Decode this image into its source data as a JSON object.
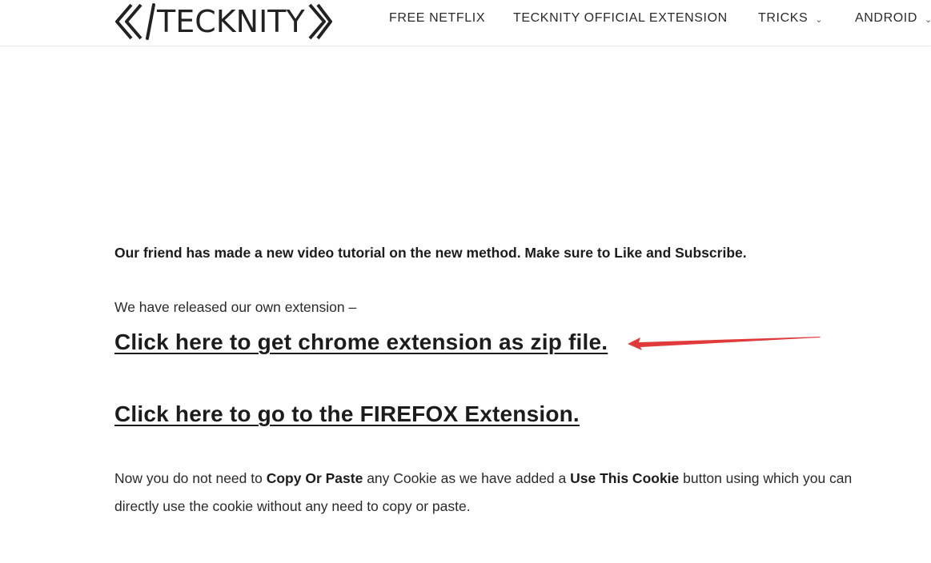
{
  "header": {
    "logo_text": "TECKNITY",
    "nav": [
      {
        "label": "FREE NETFLIX",
        "has_dropdown": false
      },
      {
        "label": "TECKNITY OFFICIAL EXTENSION",
        "has_dropdown": false
      },
      {
        "label": "TRICKS",
        "has_dropdown": true
      },
      {
        "label": "ANDROID",
        "has_dropdown": true
      }
    ],
    "dropdown_icon": "chevron-down-icon"
  },
  "content": {
    "intro": "Our friend has made a new video tutorial on the new method. Make sure to Like and Subscribe.",
    "released": "We have released our own extension –",
    "chrome_link": "Click here to get chrome extension as zip file.",
    "firefox_link": "Click here to go to the FIREFOX Extension.",
    "para": {
      "part1": "Now you do not need to ",
      "bold1": "Copy Or Paste",
      "part2": " any Cookie as we have added a ",
      "bold2": "Use This Cookie",
      "part3": " button using which you can directly use the cookie without any need to copy or paste."
    }
  },
  "colors": {
    "arrow": "#e03a3a",
    "text": "#1c1c1c",
    "background": "#ffffff"
  }
}
